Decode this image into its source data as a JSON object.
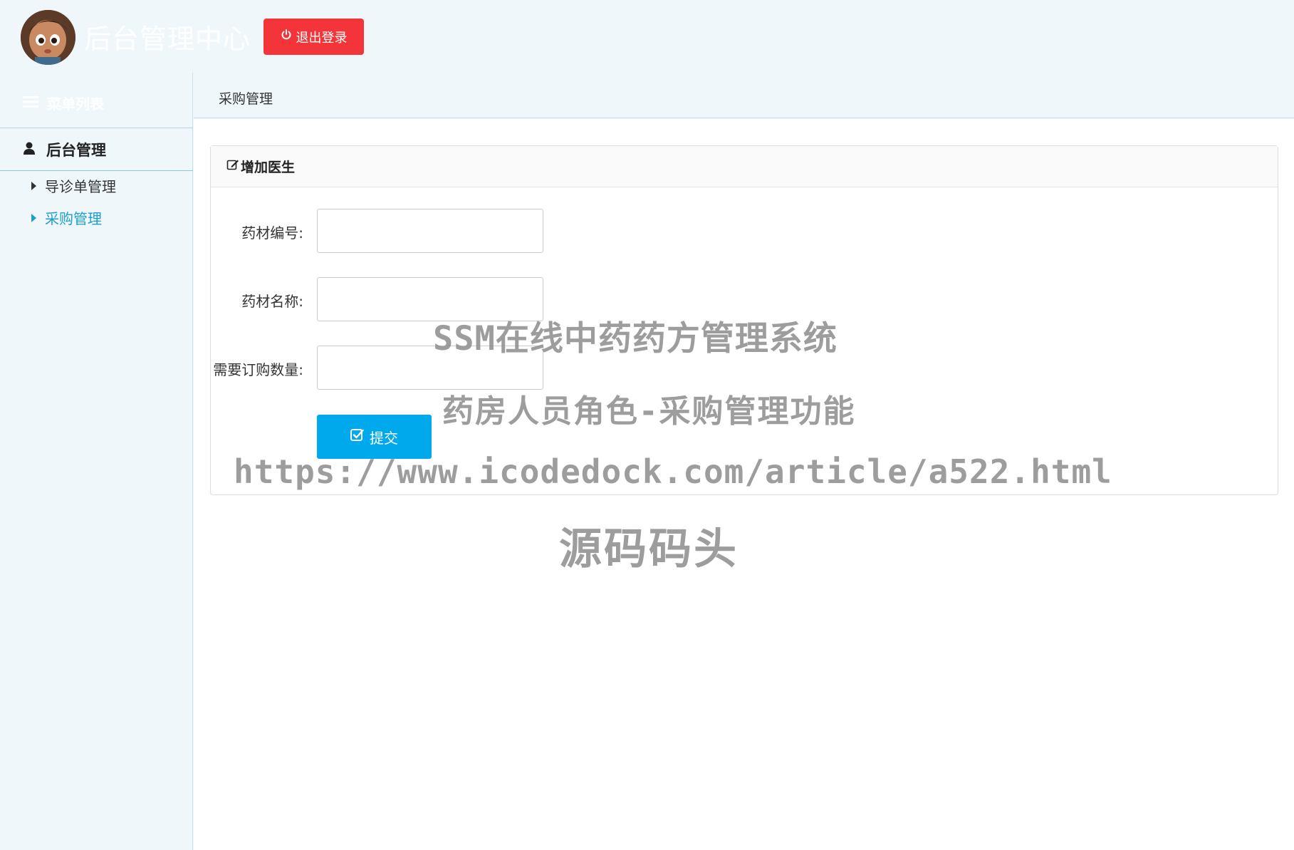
{
  "header": {
    "site_title": "后台管理中心",
    "logout_label": "退出登录",
    "logout_color": "#f3353a"
  },
  "sidebar": {
    "menu_title": "菜单列表",
    "group_label": "后台管理",
    "items": [
      {
        "label": "导诊单管理",
        "active": false
      },
      {
        "label": "采购管理",
        "active": true
      }
    ],
    "active_color": "#1a9fd0"
  },
  "tab": {
    "label": "采购管理"
  },
  "panel": {
    "heading": "增加医生",
    "fields": [
      {
        "label": "药材编号:",
        "value": ""
      },
      {
        "label": "药材名称:",
        "value": ""
      },
      {
        "label": "需要订购数量:",
        "value": ""
      }
    ],
    "submit_label": "提交",
    "submit_color": "#00a8ec"
  },
  "watermark": {
    "line1": "SSM在线中药药方管理系统",
    "line2": "药房人员角色-采购管理功能",
    "line3": "https://www.icodedock.com/article/a522.html",
    "line4": "源码码头"
  },
  "icons": {
    "avatar": "avatar-image",
    "logout": "power-icon",
    "menu": "list-icon",
    "group": "user-icon",
    "heading": "edit-icon",
    "submit": "check-square-icon"
  }
}
